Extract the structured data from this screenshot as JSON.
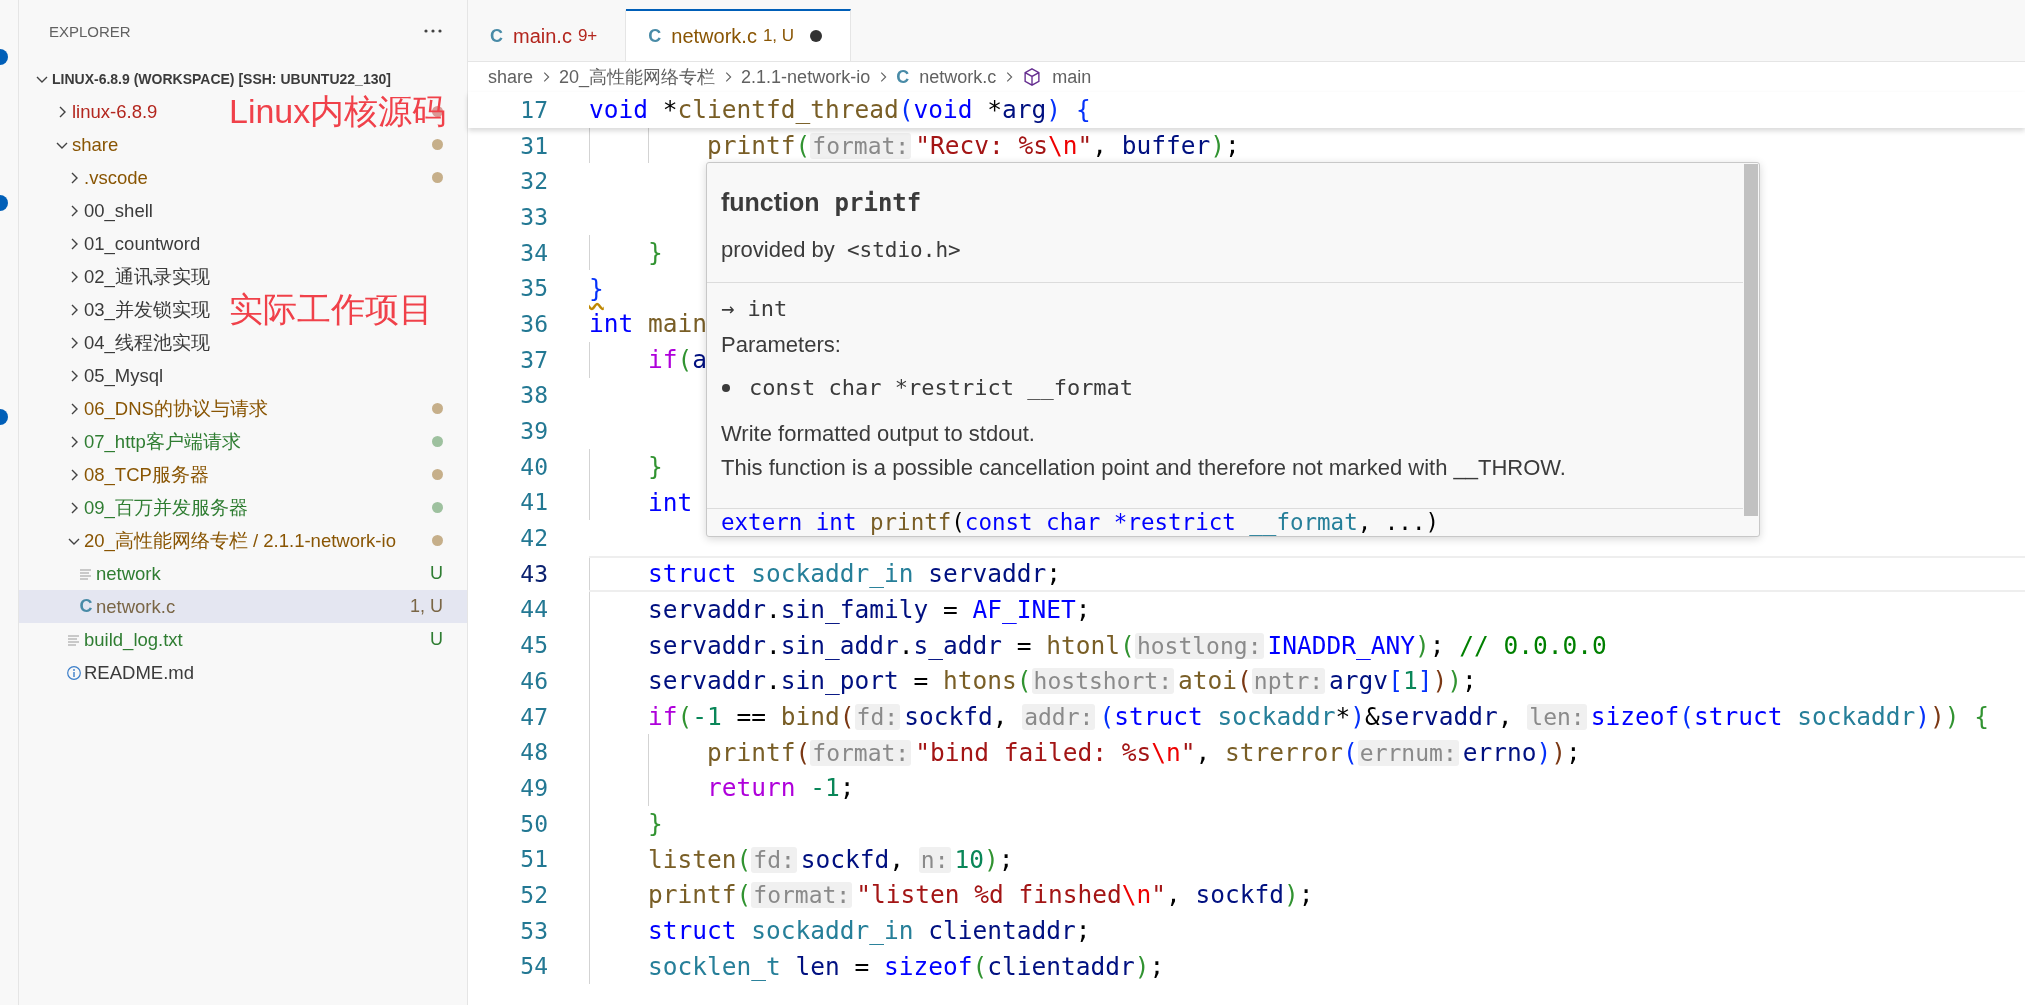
{
  "explorer": {
    "title": "EXPLORER",
    "tree": [
      {
        "label": "LINUX-6.8.9 (WORKSPACE) [SSH: UBUNTU22_130]",
        "kind": "workspace",
        "expanded": true,
        "selected": false,
        "children": [
          {
            "label": "linux-6.8.9",
            "kind": "folder",
            "expanded": false,
            "selected": false,
            "color": "#b3261e",
            "dot": true,
            "annotation": "Linux内核源码"
          },
          {
            "label": "share",
            "kind": "folder",
            "expanded": true,
            "selected": false,
            "color": "#895503",
            "dot": true,
            "children": [
              {
                "label": ".vscode",
                "kind": "folder",
                "expanded": false,
                "selected": false,
                "color": "#895503",
                "dot": true
              },
              {
                "label": "00_shell",
                "kind": "folder",
                "expanded": false,
                "selected": false
              },
              {
                "label": "01_countword",
                "kind": "folder",
                "expanded": false,
                "selected": false
              },
              {
                "label": "02_通讯录实现",
                "kind": "folder",
                "expanded": false,
                "selected": false
              },
              {
                "label": "03_并发锁实现",
                "kind": "folder",
                "expanded": false,
                "selected": false,
                "annotation": "实际工作项目"
              },
              {
                "label": "04_线程池实现",
                "kind": "folder",
                "expanded": false,
                "selected": false
              },
              {
                "label": "05_Mysql",
                "kind": "folder",
                "expanded": false,
                "selected": false
              },
              {
                "label": "06_DNS的协议与请求",
                "kind": "folder",
                "expanded": false,
                "selected": false,
                "color": "#895503",
                "dot": true
              },
              {
                "label": "07_http客户端请求",
                "kind": "folder",
                "expanded": false,
                "selected": false,
                "color": "#2f7d32",
                "dot": true
              },
              {
                "label": "08_TCP服务器",
                "kind": "folder",
                "expanded": false,
                "selected": false,
                "color": "#895503",
                "dot": true
              },
              {
                "label": "09_百万并发服务器",
                "kind": "folder",
                "expanded": false,
                "selected": false,
                "color": "#2f7d32",
                "dot": true
              },
              {
                "label": "20_高性能网络专栏 / 2.1.1-network-io",
                "kind": "folder",
                "expanded": true,
                "selected": false,
                "color": "#895503",
                "dot": true,
                "children": [
                  {
                    "label": "network",
                    "kind": "text-file",
                    "selected": false,
                    "color": "#2f7d32",
                    "decoration": "U"
                  },
                  {
                    "label": "network.c",
                    "kind": "c-file",
                    "icon": "C",
                    "selected": true,
                    "color": "#7a6646",
                    "decoration": "1, U"
                  }
                ]
              },
              {
                "label": "build_log.txt",
                "kind": "text-file",
                "selected": false,
                "color": "#2f7d32",
                "decoration": "U"
              },
              {
                "label": "README.md",
                "kind": "info-file",
                "selected": false
              }
            ]
          }
        ]
      }
    ]
  },
  "tabs": [
    {
      "icon": "C",
      "label": "main.c",
      "badge": "9+",
      "color": "#b3261e",
      "dirty": false,
      "selected": false
    },
    {
      "icon": "C",
      "label": "network.c",
      "badge": "1, U",
      "color": "#895503",
      "dirty": true,
      "selected": true
    }
  ],
  "breadcrumb": [
    {
      "kind": "folder",
      "label": "share"
    },
    {
      "kind": "folder",
      "label": "20_高性能网络专栏"
    },
    {
      "kind": "folder",
      "label": "2.1.1-network-io"
    },
    {
      "kind": "file",
      "icon": "C",
      "label": "network.c"
    },
    {
      "kind": "symbol",
      "label": "main"
    }
  ],
  "sticky_line": {
    "number": "17",
    "tokens": [
      {
        "text": "void",
        "kind": "kw"
      },
      {
        "text": " *",
        "kind": "p"
      },
      {
        "text": "clientfd_thread",
        "kind": "fn"
      },
      {
        "text": "(",
        "kind": "b1"
      },
      {
        "text": "void",
        "kind": "kw"
      },
      {
        "text": " *",
        "kind": "p"
      },
      {
        "text": "arg",
        "kind": "var"
      },
      {
        "text": ")",
        "kind": "b1"
      },
      {
        "text": " {",
        "kind": "b1"
      }
    ]
  },
  "lines": [
    {
      "number": "31",
      "current": false,
      "tokens": [
        {
          "text": "        printf",
          "kind": "fn"
        },
        {
          "text": "(",
          "kind": "b2"
        },
        {
          "text": "format:",
          "kind": "hint"
        },
        {
          "text": "\"Recv: %s",
          "kind": "str"
        },
        {
          "text": "\\n",
          "kind": "esc"
        },
        {
          "text": "\"",
          "kind": "str"
        },
        {
          "text": ", ",
          "kind": "p"
        },
        {
          "text": "buffer",
          "kind": "var"
        },
        {
          "text": ")",
          "kind": "b2"
        },
        {
          "text": ";",
          "kind": "p"
        }
      ]
    },
    {
      "number": "32",
      "current": false
    },
    {
      "number": "33",
      "current": false
    },
    {
      "number": "34",
      "current": false,
      "tokens": [
        {
          "text": "    }",
          "kind": "b2"
        }
      ]
    },
    {
      "number": "35",
      "current": false,
      "tokens": [
        {
          "text": "}",
          "kind": "squiggle"
        }
      ]
    },
    {
      "number": "36",
      "current": false,
      "tokens": [
        {
          "text": "int ",
          "kind": "kw"
        },
        {
          "text": "main",
          "kind": "fn"
        }
      ]
    },
    {
      "number": "37",
      "current": false,
      "tokens": [
        {
          "text": "    if",
          "kind": "ctl"
        },
        {
          "text": "(",
          "kind": "b2"
        },
        {
          "text": "a",
          "kind": "var"
        }
      ]
    },
    {
      "number": "38",
      "current": false
    },
    {
      "number": "39",
      "current": false
    },
    {
      "number": "40",
      "current": false,
      "tokens": [
        {
          "text": "    }",
          "kind": "b2"
        }
      ]
    },
    {
      "number": "41",
      "current": false,
      "tokens": [
        {
          "text": "    int",
          "kind": "kw"
        }
      ]
    },
    {
      "number": "42",
      "current": false
    },
    {
      "number": "43",
      "current": true,
      "tokens": [
        {
          "text": "    struct ",
          "kind": "kw"
        },
        {
          "text": "sockaddr_in",
          "kind": "type"
        },
        {
          "text": " servaddr",
          "kind": "var"
        },
        {
          "text": ";",
          "kind": "p"
        }
      ]
    },
    {
      "number": "44",
      "current": false,
      "tokens": [
        {
          "text": "    servaddr",
          "kind": "var"
        },
        {
          "text": ".",
          "kind": "p"
        },
        {
          "text": "sin_family",
          "kind": "var"
        },
        {
          "text": " = ",
          "kind": "p"
        },
        {
          "text": "AF_INET",
          "kind": "macro"
        },
        {
          "text": ";",
          "kind": "p"
        }
      ]
    },
    {
      "number": "45",
      "current": false,
      "tokens": [
        {
          "text": "    servaddr",
          "kind": "var"
        },
        {
          "text": ".",
          "kind": "p"
        },
        {
          "text": "sin_addr",
          "kind": "var"
        },
        {
          "text": ".",
          "kind": "p"
        },
        {
          "text": "s_addr",
          "kind": "var"
        },
        {
          "text": " = ",
          "kind": "p"
        },
        {
          "text": "htonl",
          "kind": "fn"
        },
        {
          "text": "(",
          "kind": "b2"
        },
        {
          "text": "hostlong:",
          "kind": "hint"
        },
        {
          "text": "INADDR_ANY",
          "kind": "macro"
        },
        {
          "text": ")",
          "kind": "b2"
        },
        {
          "text": "; ",
          "kind": "p"
        },
        {
          "text": "// 0.0.0.0",
          "kind": "cmt"
        }
      ]
    },
    {
      "number": "46",
      "current": false,
      "tokens": [
        {
          "text": "    servaddr",
          "kind": "var"
        },
        {
          "text": ".",
          "kind": "p"
        },
        {
          "text": "sin_port",
          "kind": "var"
        },
        {
          "text": " = ",
          "kind": "p"
        },
        {
          "text": "htons",
          "kind": "fn"
        },
        {
          "text": "(",
          "kind": "b2"
        },
        {
          "text": "hostshort:",
          "kind": "hint"
        },
        {
          "text": "atoi",
          "kind": "fn"
        },
        {
          "text": "(",
          "kind": "b3"
        },
        {
          "text": "nptr:",
          "kind": "hint"
        },
        {
          "text": "argv",
          "kind": "var"
        },
        {
          "text": "[",
          "kind": "b1"
        },
        {
          "text": "1",
          "kind": "num"
        },
        {
          "text": "]",
          "kind": "b1"
        },
        {
          "text": ")",
          "kind": "b3"
        },
        {
          "text": ")",
          "kind": "b2"
        },
        {
          "text": ";",
          "kind": "p"
        }
      ]
    },
    {
      "number": "47",
      "current": false,
      "tokens": [
        {
          "text": "    if",
          "kind": "ctl"
        },
        {
          "text": "(",
          "kind": "b2"
        },
        {
          "text": "-1",
          "kind": "num"
        },
        {
          "text": " == ",
          "kind": "p"
        },
        {
          "text": "bind",
          "kind": "fn"
        },
        {
          "text": "(",
          "kind": "b3"
        },
        {
          "text": "fd:",
          "kind": "hint"
        },
        {
          "text": "sockfd",
          "kind": "var"
        },
        {
          "text": ", ",
          "kind": "p"
        },
        {
          "text": "addr:",
          "kind": "hint"
        },
        {
          "text": "(",
          "kind": "b1"
        },
        {
          "text": "struct ",
          "kind": "kw"
        },
        {
          "text": "sockaddr",
          "kind": "type"
        },
        {
          "text": "*",
          "kind": "p"
        },
        {
          "text": ")",
          "kind": "b1"
        },
        {
          "text": "&",
          "kind": "p"
        },
        {
          "text": "servaddr",
          "kind": "var"
        },
        {
          "text": ", ",
          "kind": "p"
        },
        {
          "text": "len:",
          "kind": "hint"
        },
        {
          "text": "sizeof",
          "kind": "kw"
        },
        {
          "text": "(",
          "kind": "b1"
        },
        {
          "text": "struct ",
          "kind": "kw"
        },
        {
          "text": "sockaddr",
          "kind": "type"
        },
        {
          "text": ")",
          "kind": "b1"
        },
        {
          "text": ")",
          "kind": "b3"
        },
        {
          "text": ")",
          "kind": "b2"
        },
        {
          "text": " {",
          "kind": "b2"
        }
      ]
    },
    {
      "number": "48",
      "current": false,
      "tokens": [
        {
          "text": "        printf",
          "kind": "fn"
        },
        {
          "text": "(",
          "kind": "b3"
        },
        {
          "text": "format:",
          "kind": "hint"
        },
        {
          "text": "\"bind failed: %s",
          "kind": "str"
        },
        {
          "text": "\\n",
          "kind": "esc"
        },
        {
          "text": "\"",
          "kind": "str"
        },
        {
          "text": ", ",
          "kind": "p"
        },
        {
          "text": "strerror",
          "kind": "fn"
        },
        {
          "text": "(",
          "kind": "b1"
        },
        {
          "text": "errnum:",
          "kind": "hint"
        },
        {
          "text": "errno",
          "kind": "var"
        },
        {
          "text": ")",
          "kind": "b1"
        },
        {
          "text": ")",
          "kind": "b3"
        },
        {
          "text": ";",
          "kind": "p"
        }
      ]
    },
    {
      "number": "49",
      "current": false,
      "tokens": [
        {
          "text": "        return ",
          "kind": "ctl"
        },
        {
          "text": "-1",
          "kind": "num"
        },
        {
          "text": ";",
          "kind": "p"
        }
      ]
    },
    {
      "number": "50",
      "current": false,
      "tokens": [
        {
          "text": "    }",
          "kind": "b2"
        }
      ]
    },
    {
      "number": "51",
      "current": false,
      "tokens": [
        {
          "text": "    listen",
          "kind": "fn"
        },
        {
          "text": "(",
          "kind": "b2"
        },
        {
          "text": "fd:",
          "kind": "hint"
        },
        {
          "text": "sockfd",
          "kind": "var"
        },
        {
          "text": ", ",
          "kind": "p"
        },
        {
          "text": "n:",
          "kind": "hint"
        },
        {
          "text": "10",
          "kind": "num"
        },
        {
          "text": ")",
          "kind": "b2"
        },
        {
          "text": ";",
          "kind": "p"
        }
      ]
    },
    {
      "number": "52",
      "current": false,
      "tokens": [
        {
          "text": "    printf",
          "kind": "fn"
        },
        {
          "text": "(",
          "kind": "b2"
        },
        {
          "text": "format:",
          "kind": "hint"
        },
        {
          "text": "\"listen %d finshed",
          "kind": "str"
        },
        {
          "text": "\\n",
          "kind": "esc"
        },
        {
          "text": "\"",
          "kind": "str"
        },
        {
          "text": ", ",
          "kind": "p"
        },
        {
          "text": "sockfd",
          "kind": "var"
        },
        {
          "text": ")",
          "kind": "b2"
        },
        {
          "text": ";",
          "kind": "p"
        }
      ]
    },
    {
      "number": "53",
      "current": false,
      "tokens": [
        {
          "text": "    struct ",
          "kind": "kw"
        },
        {
          "text": "sockaddr_in",
          "kind": "type"
        },
        {
          "text": " clientaddr",
          "kind": "var"
        },
        {
          "text": ";",
          "kind": "p"
        }
      ]
    },
    {
      "number": "54",
      "current": false,
      "tokens": [
        {
          "text": "    socklen_t",
          "kind": "type"
        },
        {
          "text": " len",
          "kind": "var"
        },
        {
          "text": " = ",
          "kind": "p"
        },
        {
          "text": "sizeof",
          "kind": "kw"
        },
        {
          "text": "(",
          "kind": "b2"
        },
        {
          "text": "clientaddr",
          "kind": "var"
        },
        {
          "text": ")",
          "kind": "b2"
        },
        {
          "text": ";",
          "kind": "p"
        }
      ]
    }
  ],
  "hover": {
    "kind_label": "function",
    "name": "printf",
    "provided_by": "provided by",
    "header": "<stdio.h>",
    "returns": "→  int",
    "parameters_label": "Parameters:",
    "parameters": [
      "const char *restrict __format"
    ],
    "description": [
      "Write formatted output to stdout.",
      "This function is a possible cancellation point and therefore not marked with __THROW."
    ],
    "signature": [
      {
        "text": "extern int ",
        "kind": "kw"
      },
      {
        "text": "printf",
        "kind": "fn"
      },
      {
        "text": "(",
        "kind": "p"
      },
      {
        "text": "const char *restrict ",
        "kind": "kw"
      },
      {
        "text": "__format",
        "kind": "type"
      },
      {
        "text": ", ...)",
        "kind": "p"
      }
    ]
  }
}
